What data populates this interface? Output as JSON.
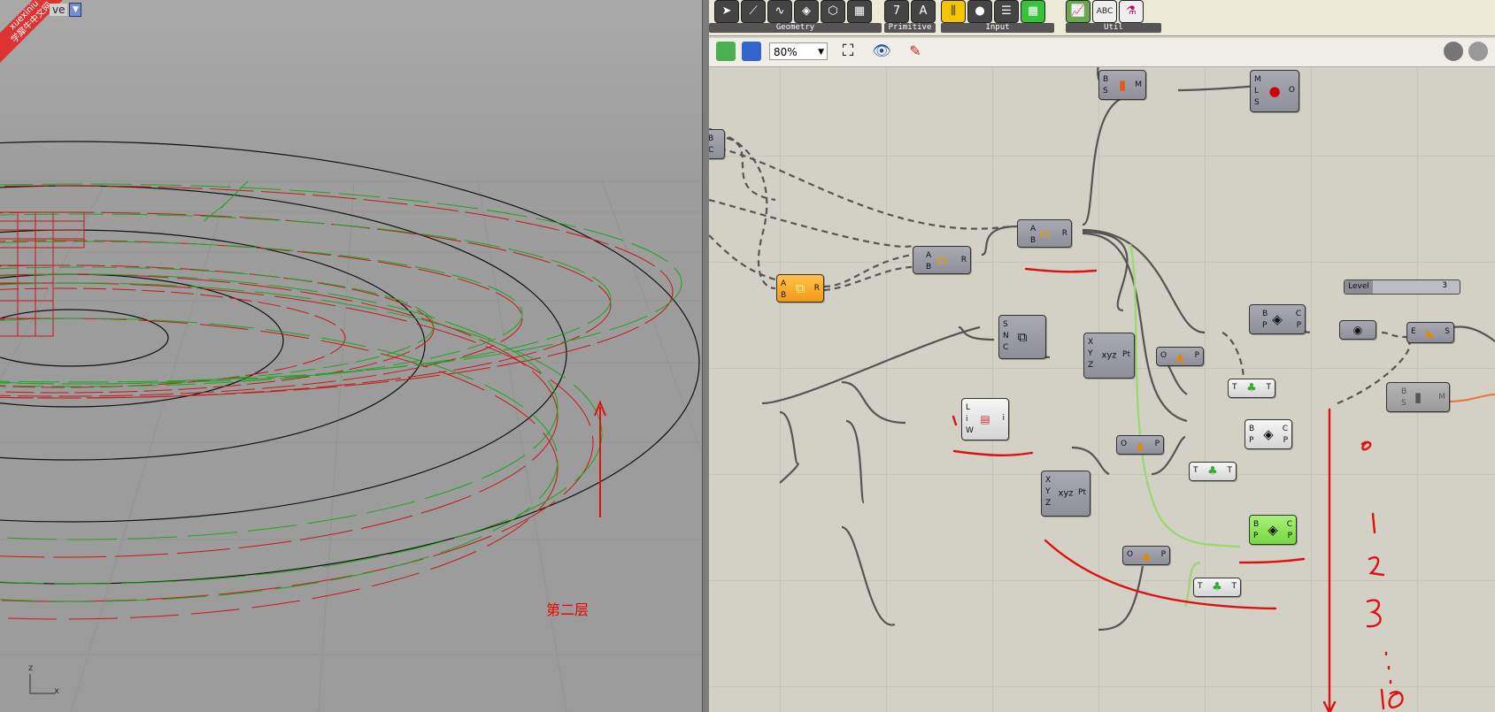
{
  "viewport": {
    "title": "Perspective",
    "title_visible": "ve",
    "dropdown_icon": "triangle-down",
    "watermark": {
      "line1": "xuexiniu",
      "line2": "学犀牛中文网"
    },
    "annotation": "第二层",
    "axis_z": "z",
    "axis_x": "x"
  },
  "ribbon": {
    "groups": [
      {
        "label": "Geometry",
        "icons": [
          "arrow-icon",
          "line-icon",
          "curve-icon",
          "surface-icon",
          "brep-icon",
          "mesh-icon"
        ]
      },
      {
        "label": "Primitive",
        "icons": [
          "7",
          "A"
        ]
      },
      {
        "label": "Input",
        "icons": [
          "slider-icon",
          "button-icon",
          "list-icon",
          "grid-icon"
        ]
      },
      {
        "label": "Util",
        "icons": [
          "graph-icon",
          "ABC",
          "flask-icon"
        ]
      }
    ]
  },
  "toolbar": {
    "zoom": "80%",
    "open_icon": "open-file-icon",
    "save_icon": "save-icon",
    "zoom_extents_icon": "zoom-extents-icon",
    "preview_icon": "eye-icon",
    "sketch_icon": "sketch-pen-icon"
  },
  "components": {
    "merge_top": {
      "ins": [
        "B",
        "S"
      ],
      "outs": [
        "M"
      ]
    },
    "sphere": {
      "ins": [
        "M",
        "L",
        "S"
      ],
      "outs": [
        "O"
      ]
    },
    "left_bc": {
      "ins": [
        "B",
        "C"
      ]
    },
    "union_1": {
      "ins": [
        "A",
        "B"
      ],
      "outs": [
        "R"
      ]
    },
    "union_2": {
      "ins": [
        "A",
        "B"
      ],
      "outs": [
        "R"
      ]
    },
    "union_3": {
      "ins": [
        "A",
        "B"
      ],
      "outs": [
        "R"
      ]
    },
    "series": {
      "ins": [
        "S",
        "N",
        "C"
      ]
    },
    "construct_pt_1": {
      "ins": [
        "X",
        "Y",
        "Z"
      ],
      "outs": [
        "Pt"
      ]
    },
    "xy_plane_1": {
      "ins": [
        "O"
      ],
      "outs": [
        "P"
      ]
    },
    "brep_plane_1": {
      "ins": [
        "B",
        "P"
      ],
      "outs": [
        "C",
        "P"
      ]
    },
    "tree_1": {
      "ins": [
        "T"
      ],
      "outs": [
        "T"
      ]
    },
    "list_item": {
      "ins": [
        "L",
        "i",
        "W"
      ],
      "outs": [
        "i"
      ]
    },
    "brep_plane_2": {
      "ins": [
        "B",
        "P"
      ],
      "outs": [
        "C",
        "P"
      ]
    },
    "xy_plane_2": {
      "ins": [
        "O"
      ],
      "outs": [
        "P"
      ]
    },
    "tree_2": {
      "ins": [
        "T"
      ],
      "outs": [
        "T"
      ]
    },
    "construct_pt_2": {
      "ins": [
        "X",
        "Y",
        "Z"
      ],
      "outs": [
        "Pt"
      ]
    },
    "brep_plane_3": {
      "ins": [
        "B",
        "P"
      ],
      "outs": [
        "C",
        "P"
      ]
    },
    "xy_plane_3": {
      "ins": [
        "O"
      ],
      "outs": [
        "P"
      ]
    },
    "tree_3": {
      "ins": [
        "T"
      ],
      "outs": [
        "T"
      ]
    },
    "extrude": {
      "ins": [
        "E"
      ],
      "outs": [
        "S"
      ]
    },
    "merge_disabled": {
      "ins": [
        "B",
        "S"
      ],
      "outs": [
        "M"
      ]
    }
  },
  "slider": {
    "name": "Level",
    "value": "3"
  },
  "colors": {
    "accent_red": "#e01010",
    "gh_canvas": "#d3d0c5",
    "comp_grey": "#9a9aa4",
    "comp_orange": "#f6a82a",
    "comp_green": "#8be05a"
  }
}
